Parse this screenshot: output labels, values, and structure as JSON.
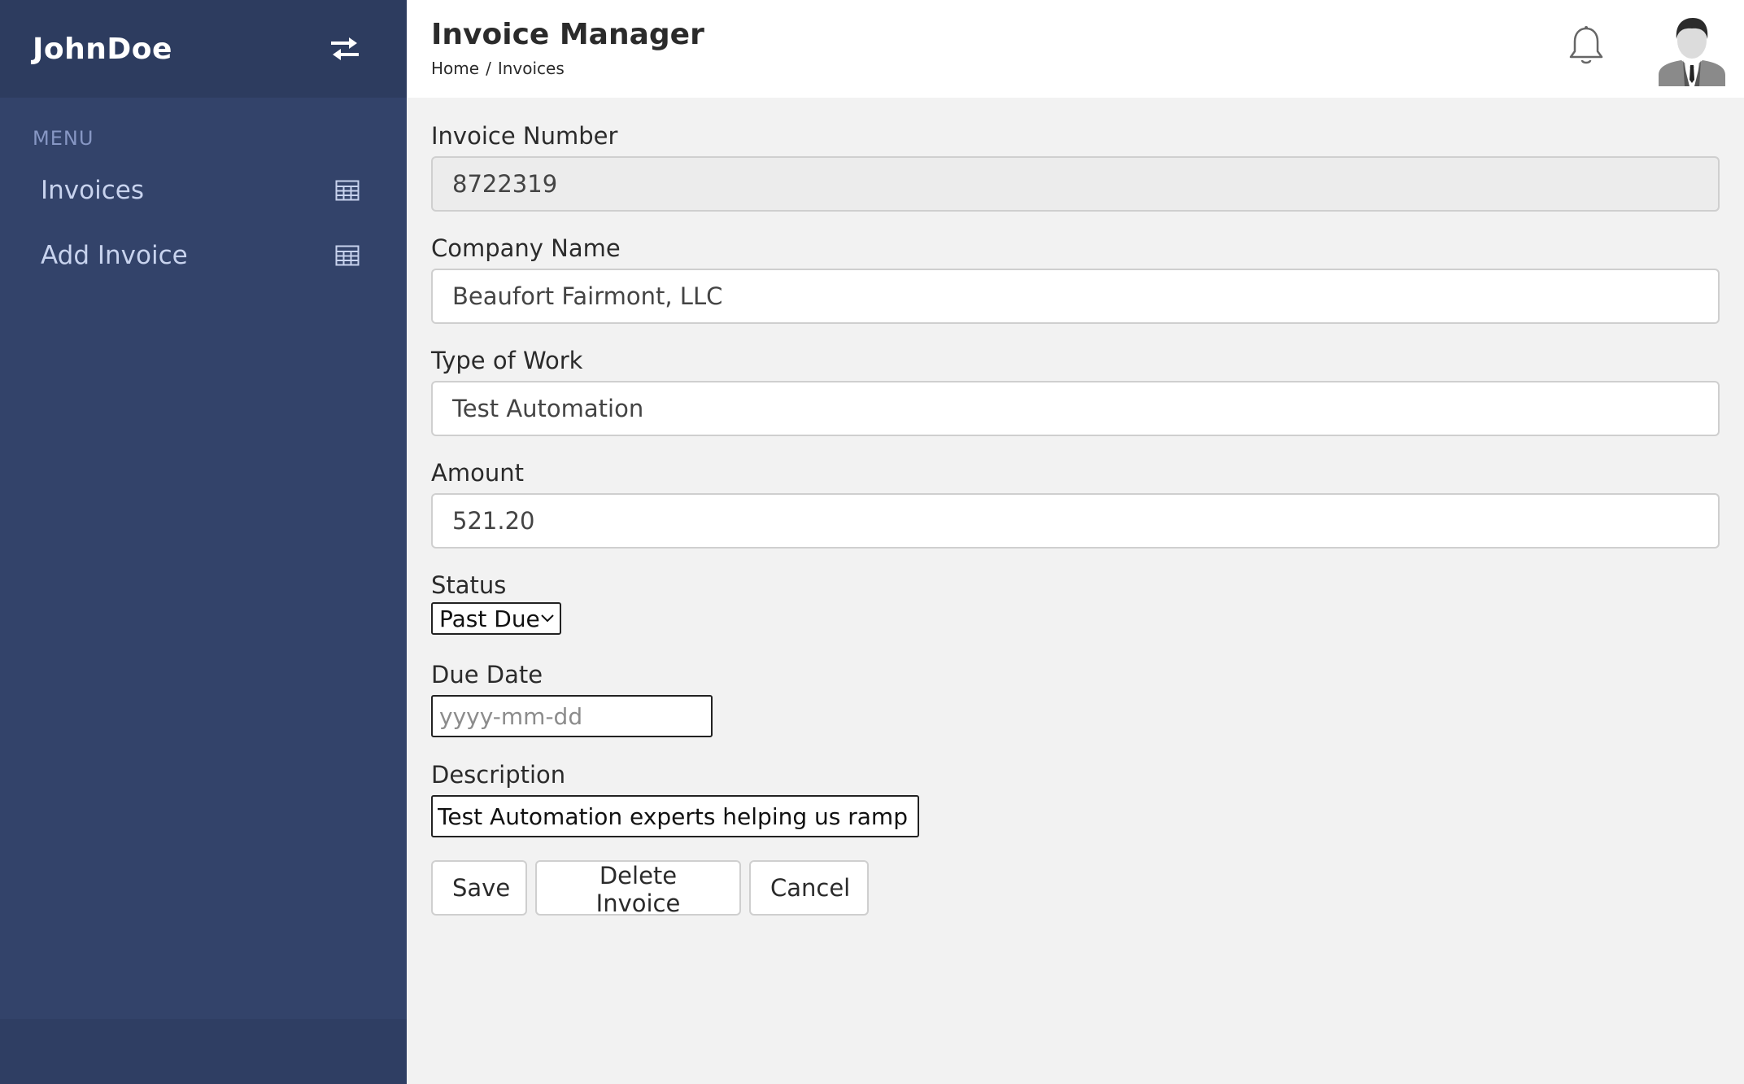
{
  "sidebar": {
    "brand": "JohnDoe",
    "menu_label": "MENU",
    "items": [
      {
        "label": "Invoices",
        "icon": "table-icon"
      },
      {
        "label": "Add Invoice",
        "icon": "table-icon"
      }
    ]
  },
  "header": {
    "title": "Invoice Manager",
    "breadcrumb": [
      "Home",
      "/",
      "Invoices"
    ]
  },
  "form": {
    "invoice_number": {
      "label": "Invoice Number",
      "value": "8722319"
    },
    "company_name": {
      "label": "Company Name",
      "value": "Beaufort Fairmont, LLC"
    },
    "type_of_work": {
      "label": "Type of Work",
      "value": "Test Automation"
    },
    "amount": {
      "label": "Amount",
      "value": "521.20"
    },
    "status": {
      "label": "Status",
      "value": "Past Due"
    },
    "due_date": {
      "label": "Due Date",
      "placeholder": "yyyy-mm-dd"
    },
    "description": {
      "label": "Description",
      "value": "Test Automation experts helping us ramp"
    }
  },
  "buttons": {
    "save": "Save",
    "delete": "Delete Invoice",
    "cancel": "Cancel"
  },
  "colors": {
    "sidebar_bg": "#33436a",
    "sidebar_header_bg": "#2d3c5f",
    "menu_label": "#8797c4",
    "nav_text": "#c8d3ee",
    "content_bg": "#f2f2f2"
  }
}
